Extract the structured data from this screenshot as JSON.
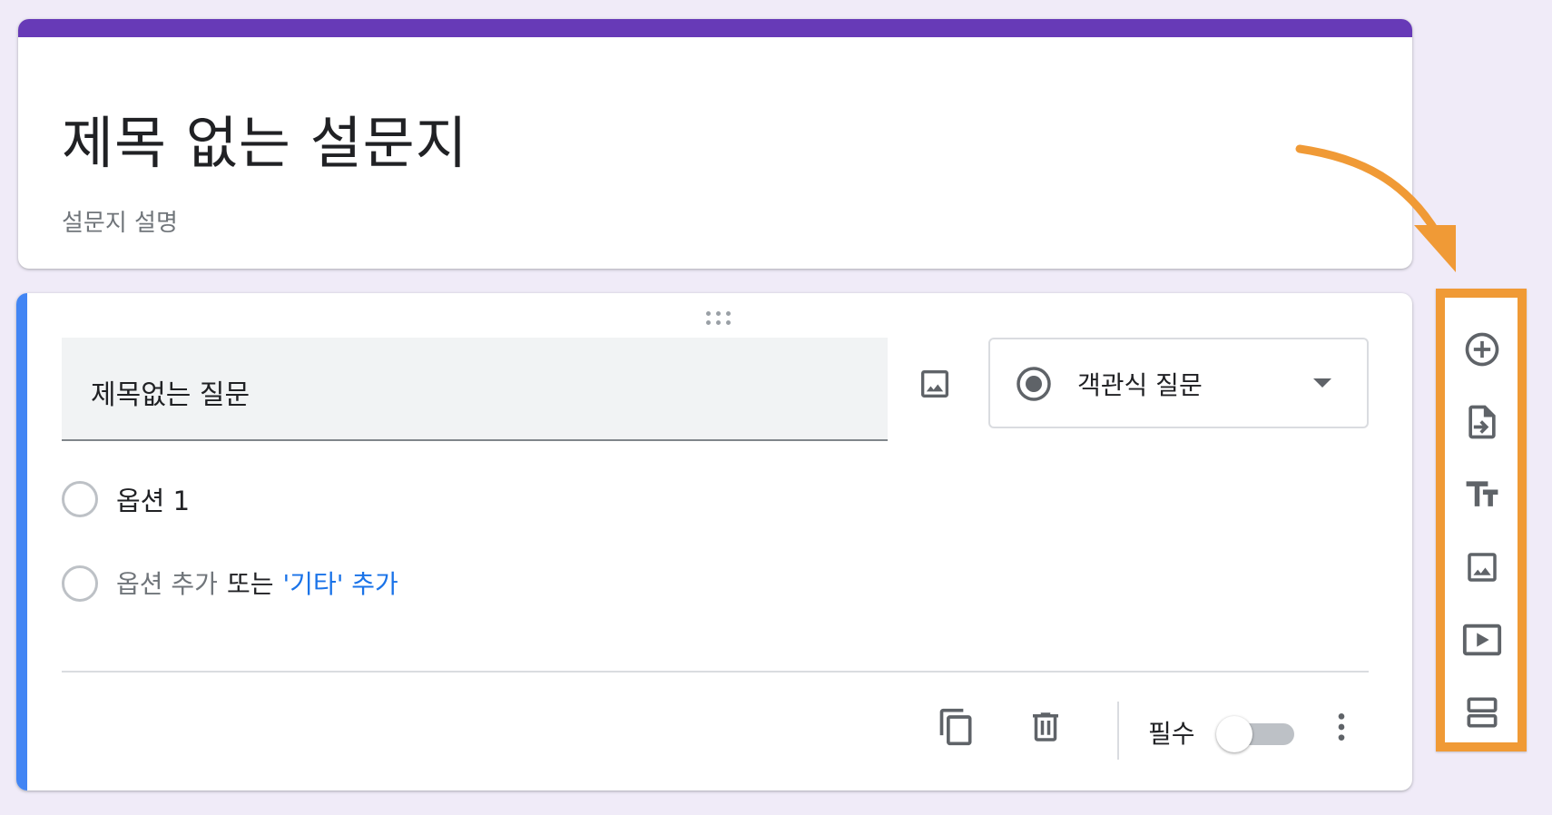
{
  "form": {
    "title": "제목 없는 설문지",
    "description": "설문지 설명"
  },
  "question": {
    "title": "제목없는 질문",
    "type_label": "객관식 질문",
    "options": [
      {
        "label": "옵션 1"
      }
    ],
    "add_option_label": "옵션 추가",
    "or_label": "또는",
    "add_other_label": "'기타' 추가",
    "required_label": "필수",
    "required": false
  },
  "toolbar": {
    "items": [
      {
        "icon": "add-circle-icon"
      },
      {
        "icon": "import-questions-icon"
      },
      {
        "icon": "title-text-icon"
      },
      {
        "icon": "image-icon"
      },
      {
        "icon": "video-icon"
      },
      {
        "icon": "section-icon"
      }
    ]
  },
  "colors": {
    "background": "#f0ebf8",
    "form_accent": "#673ab7",
    "active_question_bar": "#4285f4",
    "link": "#1a73e8",
    "annotation": "#f09a36"
  }
}
